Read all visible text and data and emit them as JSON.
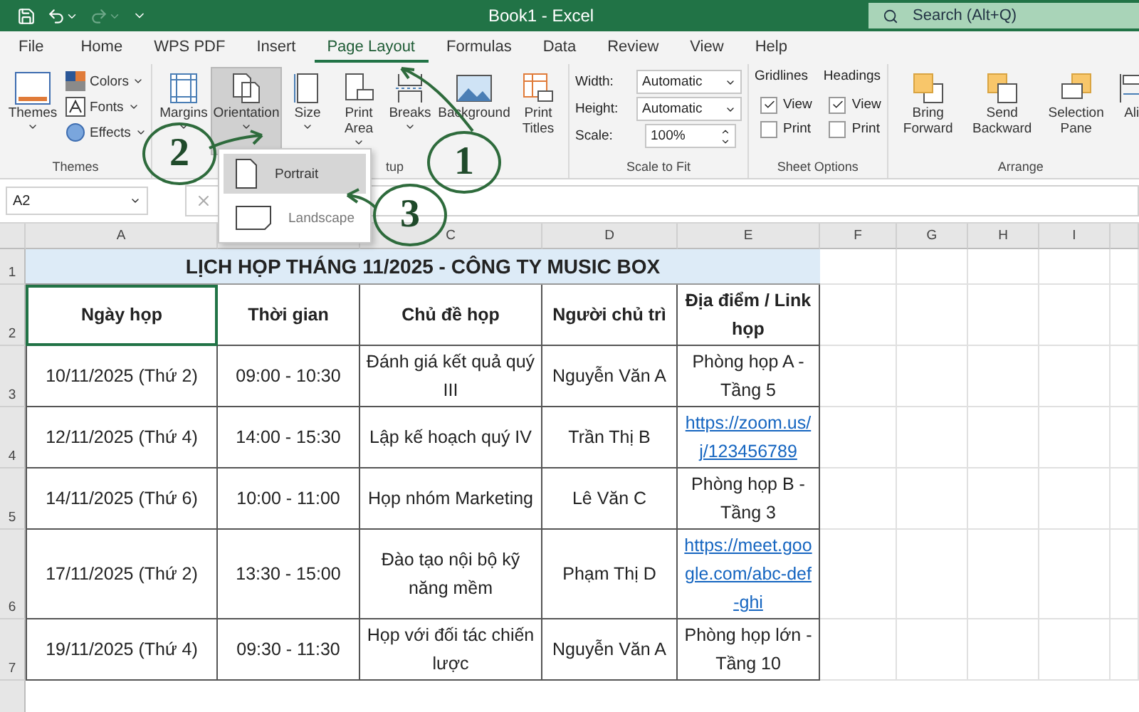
{
  "title_bar": {
    "quick_access": [
      {
        "kind": "save",
        "disabled": false
      },
      {
        "kind": "undo",
        "disabled": false
      },
      {
        "kind": "redo",
        "disabled": true
      }
    ],
    "document_title": "Book1  -  Excel",
    "search": {
      "placeholder": "Search (Alt+Q)"
    }
  },
  "tabs": [
    {
      "label": "File",
      "selected": false
    },
    {
      "label": "Home",
      "selected": false
    },
    {
      "label": "WPS PDF",
      "selected": false
    },
    {
      "label": "Insert",
      "selected": false
    },
    {
      "label": "Page Layout",
      "selected": true
    },
    {
      "label": "Formulas",
      "selected": false
    },
    {
      "label": "Data",
      "selected": false
    },
    {
      "label": "Review",
      "selected": false
    },
    {
      "label": "View",
      "selected": false
    },
    {
      "label": "Help",
      "selected": false
    }
  ],
  "themes_group": {
    "label": "Themes",
    "button": "Themes",
    "options": [
      {
        "label": "Colors",
        "kind": "colors"
      },
      {
        "label": "Fonts",
        "kind": "fonts"
      },
      {
        "label": "Effects",
        "kind": "effects"
      }
    ]
  },
  "page_setup_group": {
    "label": "tup",
    "buttons": [
      {
        "label": "Margins",
        "kind": "margins",
        "selected": false
      },
      {
        "label": "Orientation",
        "kind": "orientation",
        "selected": true
      },
      {
        "label": "Size",
        "kind": "size",
        "selected": false
      },
      {
        "label": "Print Area",
        "kind": "printarea",
        "selected": false
      },
      {
        "label": "Breaks",
        "kind": "breaks",
        "selected": false
      },
      {
        "label": "Background",
        "kind": "background",
        "selected": false
      },
      {
        "label": "Print Titles",
        "kind": "printtitles",
        "selected": false
      }
    ]
  },
  "scale_to_fit": {
    "label": "Scale to Fit",
    "fields": [
      {
        "label": "Width:",
        "value": "Automatic",
        "kind": "select"
      },
      {
        "label": "Height:",
        "value": "Automatic",
        "kind": "select"
      },
      {
        "label": "Scale:",
        "value": "100%",
        "kind": "spin"
      }
    ]
  },
  "sheet_options": {
    "label": "Sheet Options",
    "columns": [
      {
        "title": "Gridlines",
        "options": [
          {
            "label": "View",
            "checked": true
          },
          {
            "label": "Print",
            "checked": false
          }
        ]
      },
      {
        "title": "Headings",
        "options": [
          {
            "label": "View",
            "checked": true
          },
          {
            "label": "Print",
            "checked": false
          }
        ]
      }
    ]
  },
  "arrange": {
    "label": "Arrange",
    "buttons": [
      {
        "label": "Bring Forward",
        "kind": "forward"
      },
      {
        "label": "Send Backward",
        "kind": "backward"
      },
      {
        "label": "Selection Pane",
        "kind": "pane"
      },
      {
        "label": "Ali",
        "kind": "align"
      }
    ]
  },
  "orientation_menu": {
    "items": [
      {
        "label": "Portrait",
        "kind": "portrait",
        "selected": true
      },
      {
        "label": "Landscape",
        "kind": "landscape",
        "selected": false
      }
    ]
  },
  "formula_bar": {
    "name_box": "A2"
  },
  "sheet": {
    "columns": [
      {
        "label": "A"
      },
      {},
      {
        "label": "C"
      },
      {
        "label": "D"
      },
      {
        "label": "E"
      },
      {
        "label": "F"
      },
      {
        "label": "G"
      },
      {
        "label": "H"
      },
      {
        "label": "I"
      }
    ],
    "title_row": {
      "number": "1",
      "text": "LỊCH HỌP THÁNG 11/2025 - CÔNG TY MUSIC BOX"
    },
    "header_row": {
      "number": "2",
      "cells": [
        "Ngày họp",
        "Thời gian",
        "Chủ đề họp",
        "Người chủ trì",
        "Địa điểm / Link họp"
      ]
    },
    "rows": [
      {
        "number": "3",
        "cells": [
          {
            "text": "10/11/2025 (Thứ 2)",
            "kind": "text"
          },
          {
            "text": "09:00 - 10:30",
            "kind": "text"
          },
          {
            "text": "Đánh giá kết quả quý III",
            "kind": "text"
          },
          {
            "text": "Nguyễn Văn A",
            "kind": "text"
          },
          {
            "text": "Phòng họp A - Tầng 5",
            "kind": "text"
          }
        ]
      },
      {
        "number": "4",
        "cells": [
          {
            "text": "12/11/2025 (Thứ 4)",
            "kind": "text"
          },
          {
            "text": "14:00 - 15:30",
            "kind": "text"
          },
          {
            "text": "Lập kế hoạch quý IV",
            "kind": "text"
          },
          {
            "text": "Trần Thị B",
            "kind": "text"
          },
          {
            "text": "https://zoom.us/j/123456789",
            "kind": "link"
          }
        ]
      },
      {
        "number": "5",
        "cells": [
          {
            "text": "14/11/2025 (Thứ 6)",
            "kind": "text"
          },
          {
            "text": "10:00 - 11:00",
            "kind": "text"
          },
          {
            "text": "Họp nhóm Marketing",
            "kind": "text"
          },
          {
            "text": "Lê Văn C",
            "kind": "text"
          },
          {
            "text": "Phòng họp B - Tầng 3",
            "kind": "text"
          }
        ]
      },
      {
        "number": "6",
        "cells": [
          {
            "text": "17/11/2025 (Thứ 2)",
            "kind": "text"
          },
          {
            "text": "13:30 - 15:00",
            "kind": "text"
          },
          {
            "text": "Đào tạo nội bộ kỹ năng mềm",
            "kind": "text"
          },
          {
            "text": "Phạm Thị D",
            "kind": "text"
          },
          {
            "text": "https://meet.google.com/abc-def-ghi",
            "kind": "link"
          }
        ]
      },
      {
        "number": "7",
        "cells": [
          {
            "text": "19/11/2025 (Thứ 4)",
            "kind": "text"
          },
          {
            "text": "09:30 - 11:30",
            "kind": "text"
          },
          {
            "text": "Họp với đối tác chiến lược",
            "kind": "text"
          },
          {
            "text": "Nguyễn Văn A",
            "kind": "text"
          },
          {
            "text": "Phòng họp lớn - Tầng 10",
            "kind": "text"
          }
        ]
      }
    ]
  },
  "annotations": [
    {
      "label": "1"
    },
    {
      "label": "2"
    },
    {
      "label": "3"
    }
  ]
}
